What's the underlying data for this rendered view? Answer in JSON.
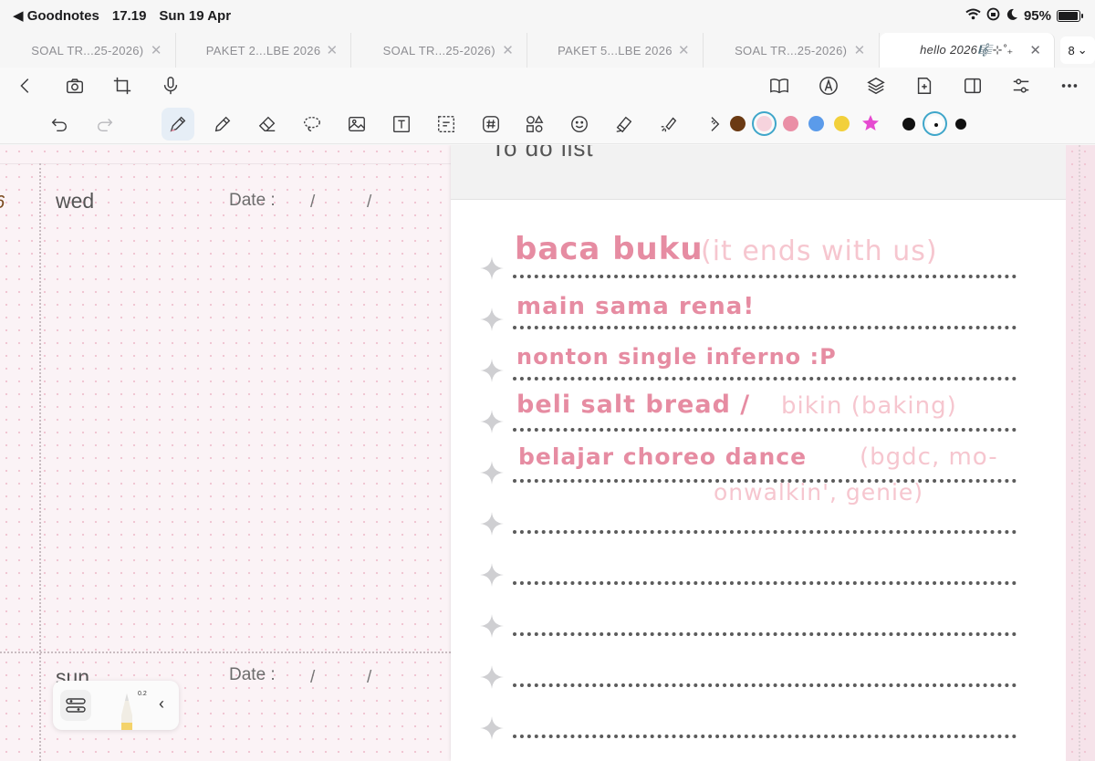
{
  "status_bar": {
    "back_app": "◀ Goodnotes",
    "time": "17.19",
    "date": "Sun 19 Apr",
    "battery": "95%",
    "battery_level": 0.95
  },
  "tabs": [
    {
      "label": "SOAL TR...25-2026)"
    },
    {
      "label": "PAKET 2...LBE 2026"
    },
    {
      "label": "SOAL TR...25-2026)"
    },
    {
      "label": "PAKET 5...LBE 2026"
    },
    {
      "label": "SOAL TR...25-2026)"
    },
    {
      "label": "hello 2026🎼⊹˚₊",
      "active": true
    }
  ],
  "tab_count": "8",
  "toolbar": {
    "left_icons": [
      "back-icon",
      "camera-icon",
      "crop-icon",
      "microphone-icon"
    ],
    "right_icons": [
      "book-icon",
      "pen-circle-icon",
      "layers-icon",
      "add-page-icon",
      "sidebar-icon",
      "sliders-icon",
      "more-icon"
    ]
  },
  "tools": [
    "undo",
    "redo",
    "pen",
    "highlighter",
    "eraser",
    "lasso",
    "image",
    "text",
    "select",
    "tag",
    "shapes",
    "sticker",
    "tape",
    "laser",
    "ruler"
  ],
  "colors": [
    "#6b3a13",
    "#f6d3dd",
    "#ea8fa6",
    "#5b9bea",
    "#f2d03b",
    "#e64ad0"
  ],
  "selected_color_index": 1,
  "planner": {
    "day1": "wed",
    "day2": "sun",
    "date_label": "Date :",
    "slash": "/",
    "partial_mark": "6"
  },
  "todo": {
    "title": "To do list",
    "items": [
      {
        "main": "baca buku",
        "extra": "(it ends with us)",
        "extra2": ""
      },
      {
        "main": "main sama rena!",
        "extra": "",
        "extra2": ""
      },
      {
        "main": "nonton single inferno :P",
        "extra": "",
        "extra2": ""
      },
      {
        "main": "beli salt bread /",
        "extra": "bikin (baking)",
        "extra2": ""
      },
      {
        "main": "belajar choreo dance",
        "extra": "(bgdc, mo-",
        "extra2": "onwalkin', genie)"
      }
    ],
    "empty_rows": 5
  },
  "pencil_widget": {
    "size": "0.2"
  }
}
